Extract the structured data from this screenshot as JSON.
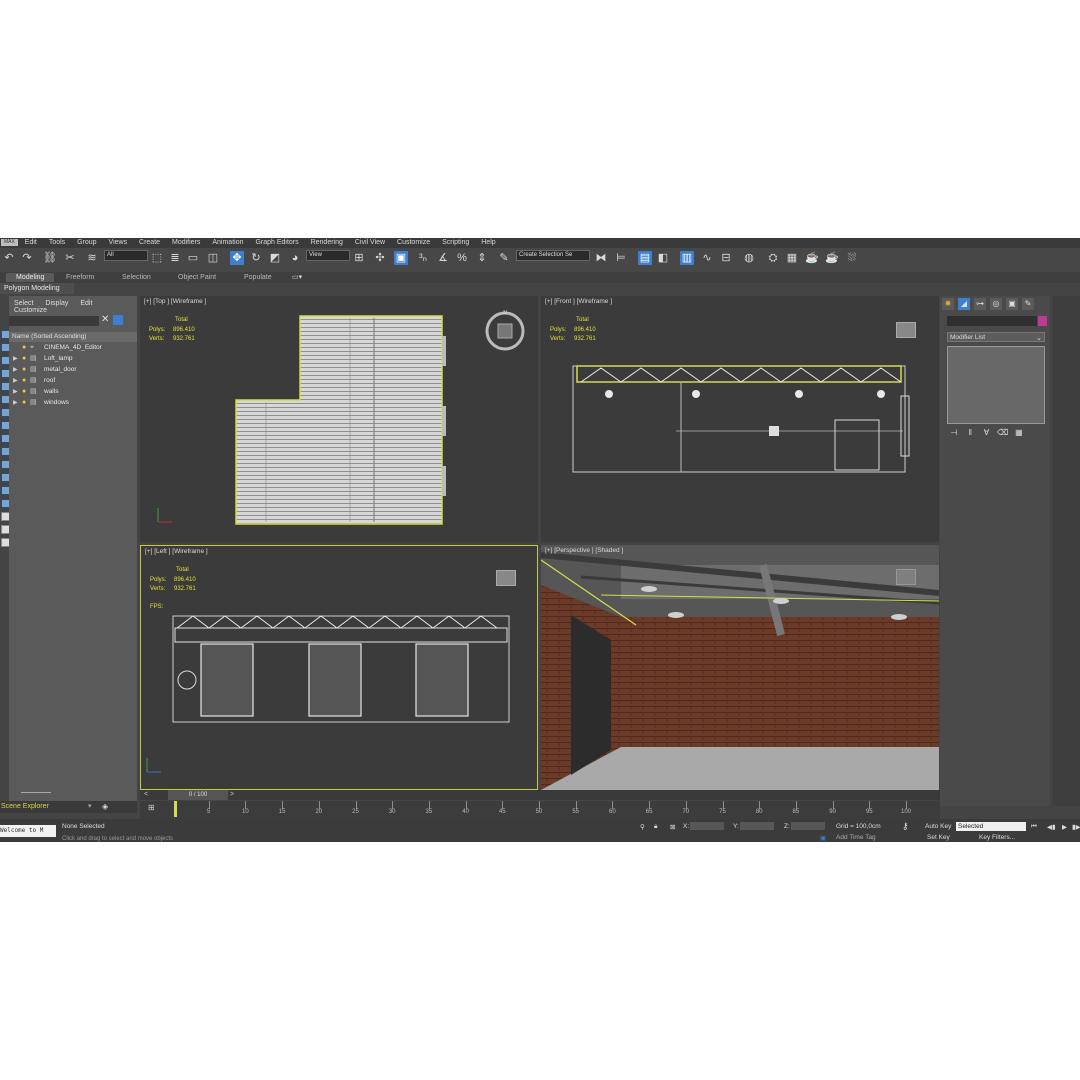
{
  "menu": {
    "logo": "MAX",
    "items": [
      "Edit",
      "Tools",
      "Group",
      "Views",
      "Create",
      "Modifiers",
      "Animation",
      "Graph Editors",
      "Rendering",
      "Civil View",
      "Customize",
      "Scripting",
      "Help"
    ]
  },
  "toolbar": {
    "filter": "All",
    "ref_coord": "View",
    "selection_set": "Create Selection Se"
  },
  "ribbon": {
    "tabs": [
      "Modeling",
      "Freeform",
      "Selection",
      "Object Paint",
      "Populate"
    ],
    "panel_label": "Polygon Modeling"
  },
  "scene_explorer": {
    "menu": [
      "Select",
      "Display",
      "Edit",
      "Customize"
    ],
    "column_header": "Name (Sorted Ascending)",
    "rows": [
      "CINEMA_4D_Editor",
      "Loft_lamp",
      "metal_door",
      "roof",
      "walls",
      "windows"
    ],
    "footer": "Scene Explorer"
  },
  "viewports": {
    "top": {
      "label": "[+] [Top ] [Wireframe ]",
      "total_label": "Total",
      "polys_label": "Polys:",
      "polys": "896.410",
      "verts_label": "Verts:",
      "verts": "932.761"
    },
    "front": {
      "label": "[+] [Front ] [Wireframe ]",
      "total_label": "Total",
      "polys_label": "Polys:",
      "polys": "896.410",
      "verts_label": "Verts:",
      "verts": "932.761"
    },
    "left": {
      "label": "[+] [Left ] [Wireframe ]",
      "total_label": "Total",
      "polys_label": "Polys:",
      "polys": "896.410",
      "verts_label": "Verts:",
      "verts": "932.761",
      "fps_label": "FPS:"
    },
    "persp": {
      "label": "[+] [Perspective ] [Shaded ]"
    }
  },
  "command_panel": {
    "modifier_list": "Modifier List"
  },
  "timeline": {
    "frame_display": "0 / 100",
    "ticks": [
      5,
      10,
      15,
      20,
      25,
      30,
      35,
      40,
      45,
      50,
      55,
      60,
      65,
      70,
      75,
      80,
      85,
      90,
      95,
      100
    ]
  },
  "status": {
    "maxscript": "Welcome to M",
    "selection": "None Selected",
    "prompt": "Click and drag to select and move objects",
    "x_label": "X:",
    "y_label": "Y:",
    "z_label": "Z:",
    "grid": "Grid = 100,0cm",
    "add_time_tag": "Add Time Tag",
    "auto_key": "Auto Key",
    "set_key": "Set Key",
    "key_mode": "Selected",
    "key_filters": "Key Filters..."
  },
  "colors": {
    "accent": "#3d7fd1",
    "stats_yellow": "#e3e13a",
    "selection_frame": "#d5db4a"
  }
}
